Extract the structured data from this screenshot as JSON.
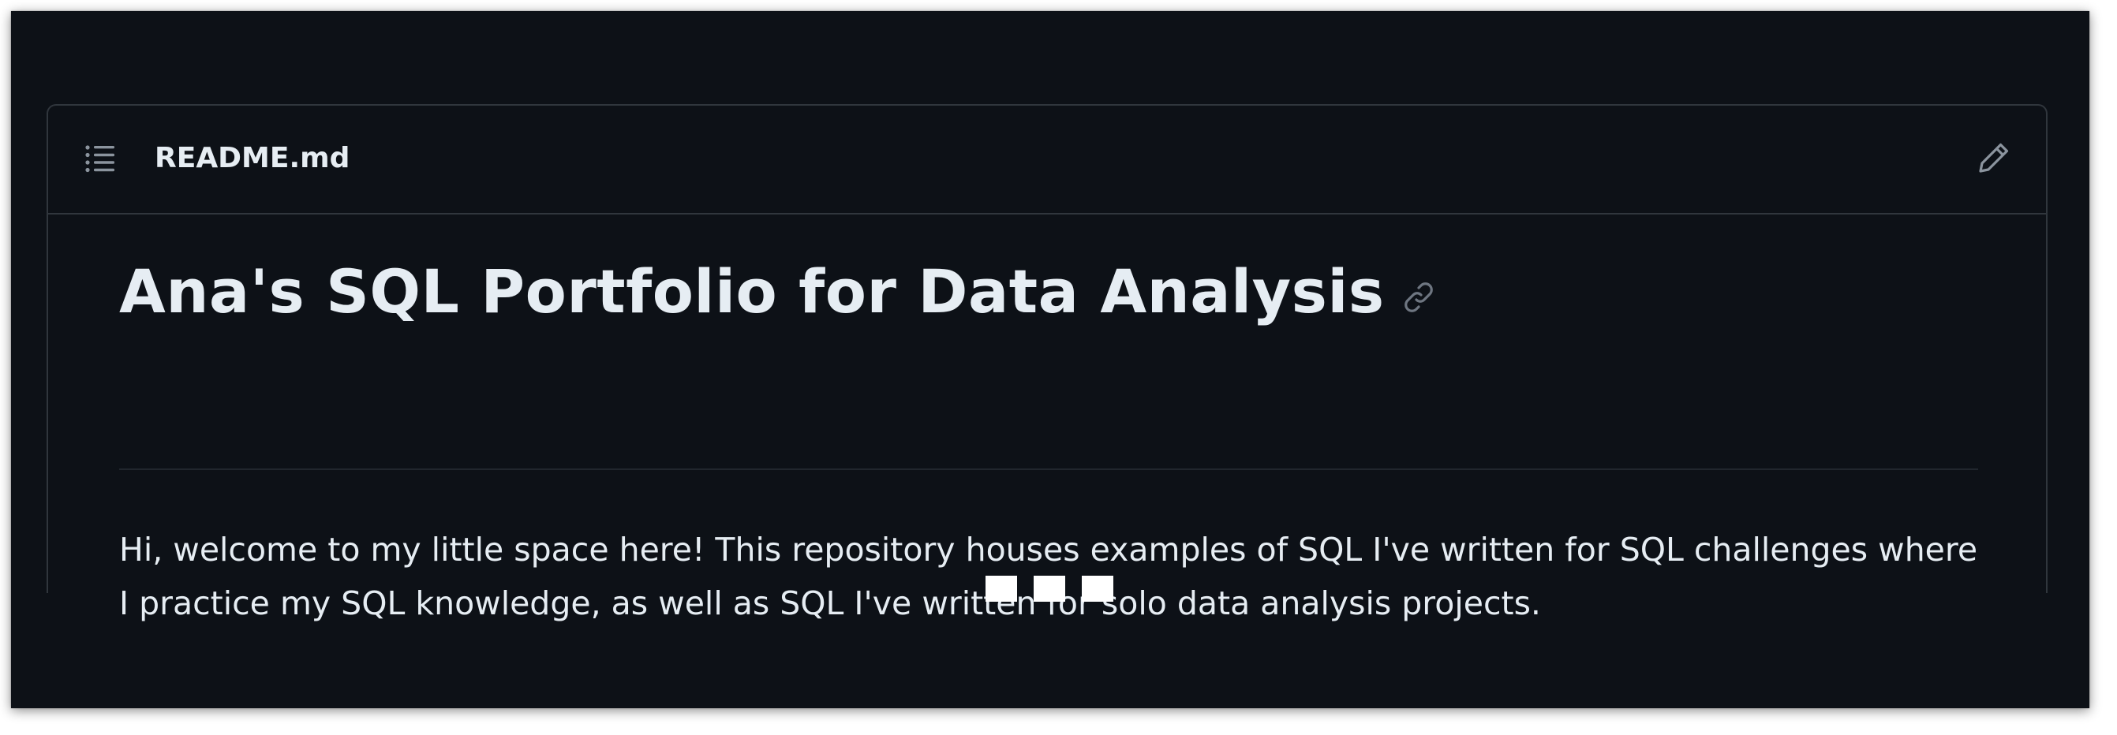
{
  "readme": {
    "filename": "README.md",
    "heading": "Ana's SQL Portfolio for Data Analysis",
    "paragraph": "Hi, welcome to my little space here! This repository houses examples of SQL I've written for SQL challenges where I practice my SQL knowledge, as well as SQL I've written for solo data analysis projects."
  },
  "icons": {
    "toc": "list-unordered-icon",
    "edit": "pencil-icon",
    "anchor": "link-icon"
  },
  "colors": {
    "background": "#0d1117",
    "border": "#30363d",
    "text": "#e6edf3",
    "muted_icon": "#8b949e"
  }
}
